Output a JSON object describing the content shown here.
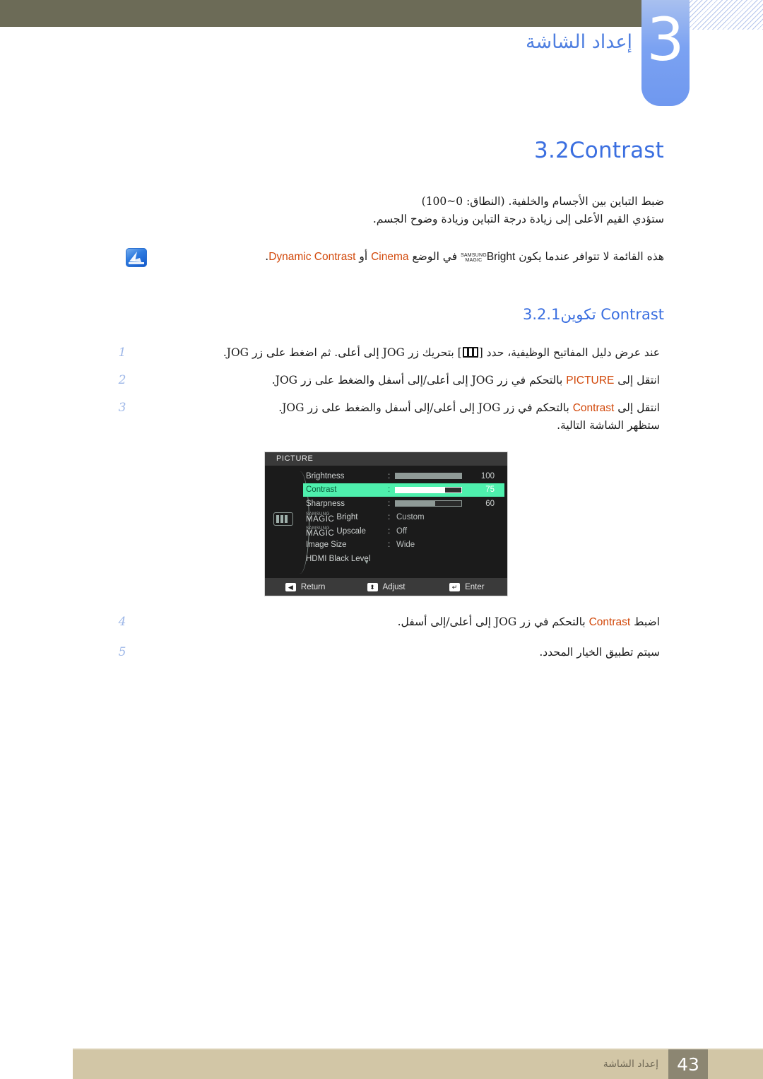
{
  "header": {
    "chapter_number": "3",
    "chapter_title": "إعداد الشاشة",
    "olive_color": "#6c6b57",
    "tab_color": "#7ba2f2"
  },
  "section": {
    "number": "3.2",
    "title": "Contrast",
    "accent_color": "#3b6fe0",
    "paragraph_line1": "ضبط التباين بين الأجسام والخلفية. (النطاق: 0~100)",
    "paragraph_line2": "ستؤدي القيم الأعلى إلى زيادة درجة التباين وزيادة وضوح الجسم."
  },
  "note": {
    "icon": "note-badge-icon",
    "text_before": "هذه القائمة لا تتوافر عندما يكون",
    "magic_top": "SAMSUNG",
    "magic_bottom": "MAGIC",
    "bright_word": "Bright",
    "text_middle": "في الوضع",
    "mode_cinema": "Cinema",
    "text_or": "أو",
    "mode_dynamic": "Dynamic Contrast",
    "text_end": "."
  },
  "subsection": {
    "number": "3.2.1",
    "title_ar": "تكوين",
    "title_en": "Contrast"
  },
  "steps": [
    {
      "num": "1",
      "icon": "picture-bars-icon",
      "text_a": "عند عرض دليل المفاتيح الوظيفية، حدد [",
      "text_b": "] بتحريك زر",
      "key": "JOG",
      "text_c": "إلى أعلى. ثم اضغط على زر",
      "key2": "JOG",
      "text_d": "."
    },
    {
      "num": "2",
      "text_a": "انتقل إلى",
      "keyword": "PICTURE",
      "text_b": "بالتحكم في زر",
      "key": "JOG",
      "text_c": "إلى أعلى/إلى أسفل والضغط على زر",
      "key2": "JOG",
      "text_d": "."
    },
    {
      "num": "3",
      "text_a": "انتقل إلى",
      "keyword": "Contrast",
      "text_b": "بالتحكم في زر",
      "key": "JOG",
      "text_c": "إلى أعلى/إلى أسفل والضغط على زر",
      "key2": "JOG",
      "text_d": ".",
      "subnote": "ستظهر الشاشة التالية."
    },
    {
      "num": "4",
      "text_a": "اضبط",
      "keyword": "Contrast",
      "text_b": "بالتحكم في زر",
      "key": "JOG",
      "text_c": "إلى أعلى/إلى أسفل.",
      "key2": "",
      "text_d": ""
    },
    {
      "num": "5",
      "text_a": "سيتم تطبيق الخيار المحدد.",
      "keyword": "",
      "text_b": "",
      "key": "",
      "text_c": "",
      "key2": "",
      "text_d": ""
    }
  ],
  "osd": {
    "title": "PICTURE",
    "side_icon": "picture-bars-icon",
    "highlight_color": "#4ef0ad",
    "rows": [
      {
        "label": "Brightness",
        "type": "slider",
        "value": "100",
        "percent": 100
      },
      {
        "label": "Contrast",
        "type": "slider",
        "value": "75",
        "percent": 75,
        "selected": true
      },
      {
        "label": "Sharpness",
        "type": "slider",
        "value": "60",
        "percent": 60
      },
      {
        "label": "Bright",
        "type": "magic",
        "value": "Custom",
        "magic_top": "SAMSUNG",
        "magic_bottom": "MAGIC"
      },
      {
        "label": "Upscale",
        "type": "magic",
        "value": "Off",
        "magic_top": "SAMSUNG",
        "magic_bottom": "MAGIC"
      },
      {
        "label": "Image Size",
        "type": "option",
        "value": "Wide"
      },
      {
        "label": "HDMI Black Level",
        "type": "plain",
        "value": ""
      }
    ],
    "more_caret": "▼",
    "footer": [
      {
        "key": "◀",
        "label": "Return"
      },
      {
        "key": "⬍",
        "label": "Adjust"
      },
      {
        "key": "↵",
        "label": "Enter"
      }
    ]
  },
  "footer": {
    "page_number": "43",
    "label": "إعداد الشاشة",
    "bar_color": "#d2c6a6",
    "page_box_color": "#8c8672"
  }
}
